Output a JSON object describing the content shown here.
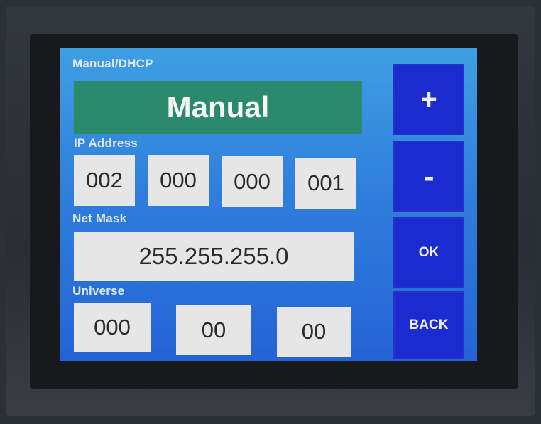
{
  "mode": {
    "label": "Manual/DHCP",
    "value": "Manual"
  },
  "ip": {
    "label": "IP Address",
    "octets": [
      "002",
      "000",
      "000",
      "001"
    ]
  },
  "netmask": {
    "label": "Net Mask",
    "value": "255.255.255.0"
  },
  "universe": {
    "label": "Universe",
    "fields": [
      "000",
      "00",
      "00"
    ]
  },
  "buttons": {
    "plus": "+",
    "minus": "-",
    "ok": "OK",
    "back": "BACK"
  },
  "colors": {
    "screen_top": "#3f9fe3",
    "screen_bottom": "#2563d6",
    "mode_bg": "#2b8a6b",
    "field_bg": "#e6e6e6",
    "button_bg": "#1b2bd0"
  }
}
